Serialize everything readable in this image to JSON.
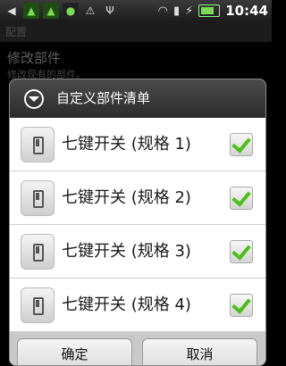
{
  "status_bar": {
    "time": "10:44",
    "icons": [
      "back-icon",
      "upload-icon",
      "upload-icon",
      "android-icon",
      "warning-icon",
      "usb-icon",
      "wifi-icon",
      "signal-icon",
      "charging-icon",
      "battery-icon"
    ]
  },
  "background": {
    "header": "配置",
    "title": "修改部件",
    "subtitle": "修改现有的部件。"
  },
  "dialog": {
    "title": "自定义部件清单",
    "items": [
      {
        "label": "七键开关 (规格 1)",
        "checked": true
      },
      {
        "label": "七键开关 (规格 2)",
        "checked": true
      },
      {
        "label": "七键开关 (规格 3)",
        "checked": true
      },
      {
        "label": "七键开关 (规格 4)",
        "checked": true
      }
    ],
    "ok_label": "确定",
    "cancel_label": "取消"
  },
  "colors": {
    "check_green": "#4cbf1a",
    "dialog_header": "#2b2b2b"
  }
}
